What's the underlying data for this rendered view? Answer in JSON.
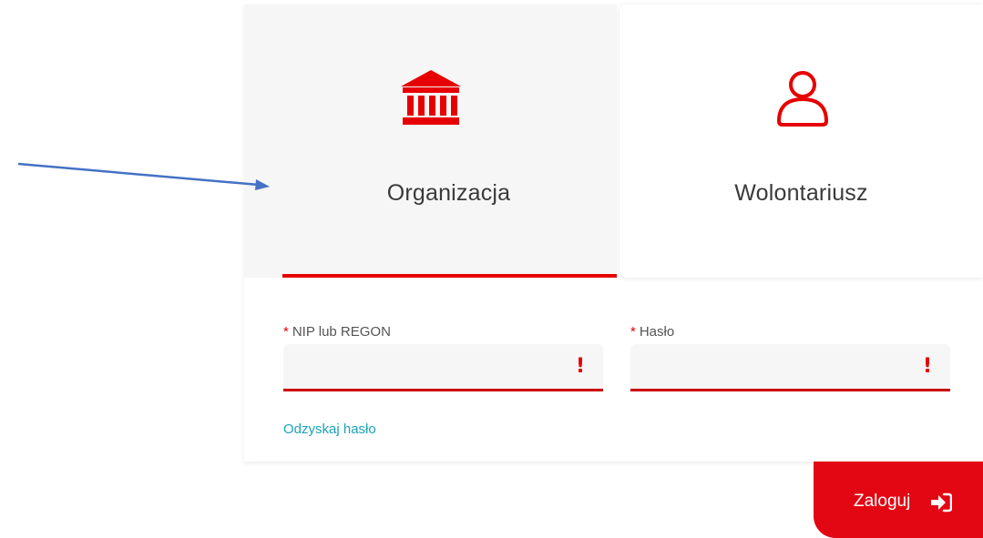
{
  "tabs": {
    "organization": {
      "label": "Organizacja",
      "icon": "institution-icon",
      "active": true
    },
    "volunteer": {
      "label": "Wolontariusz",
      "icon": "user-icon",
      "active": false
    }
  },
  "form": {
    "nip": {
      "required_mark": "*",
      "label": "NIP lub REGON",
      "value": "",
      "error_mark": "!"
    },
    "password": {
      "required_mark": "*",
      "label": "Hasło",
      "value": "",
      "error_mark": "!"
    },
    "recover_link": "Odzyskaj hasło"
  },
  "login_button": {
    "label": "Zaloguj",
    "icon": "sign-in-icon"
  },
  "colors": {
    "accent": "#e30613",
    "link": "#1aa3b5",
    "arrow": "#4472c4",
    "tab_active_bg": "#f6f6f6"
  }
}
